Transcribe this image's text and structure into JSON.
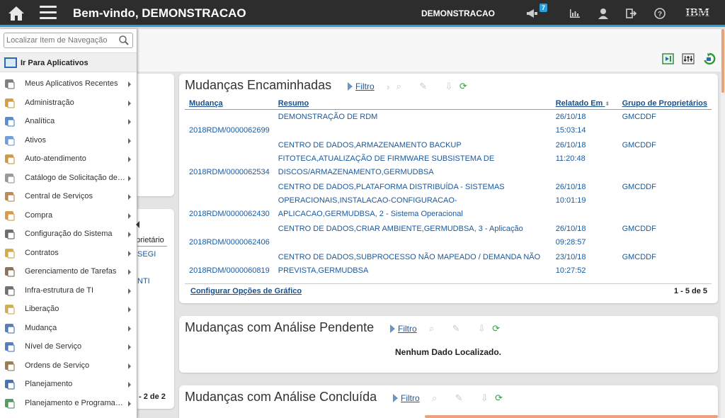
{
  "topbar": {
    "title": "Bem-vindo, DEMONSTRACAO",
    "user": "DEMONSTRACAO",
    "notification_count": "7",
    "brand": "IBM"
  },
  "nav": {
    "search_placeholder": "Localizar Item de Navegação",
    "goto_label": "Ir Para Aplicativos",
    "items": [
      {
        "label": "Meus Aplicativos Recentes",
        "icon": "clock-icon"
      },
      {
        "label": "Administração",
        "icon": "admin-icon"
      },
      {
        "label": "Analítica",
        "icon": "analytics-icon"
      },
      {
        "label": "Ativos",
        "icon": "assets-icon"
      },
      {
        "label": "Auto-atendimento",
        "icon": "cart-icon"
      },
      {
        "label": "Catálogo de Solicitação de Serviço",
        "icon": "catalog-icon"
      },
      {
        "label": "Central de Serviços",
        "icon": "service-desk-icon"
      },
      {
        "label": "Compra",
        "icon": "purchase-icon"
      },
      {
        "label": "Configuração do Sistema",
        "icon": "sliders-icon"
      },
      {
        "label": "Contratos",
        "icon": "contract-icon"
      },
      {
        "label": "Gerenciamento de Tarefas",
        "icon": "briefcase-icon"
      },
      {
        "label": "Infra-estrutura de TI",
        "icon": "computer-icon"
      },
      {
        "label": "Liberação",
        "icon": "release-icon"
      },
      {
        "label": "Mudança",
        "icon": "change-icon"
      },
      {
        "label": "Nível de Serviço",
        "icon": "service-level-icon"
      },
      {
        "label": "Ordens de Serviço",
        "icon": "work-order-icon"
      },
      {
        "label": "Planejamento",
        "icon": "planning-icon"
      },
      {
        "label": "Planejamento e Programação",
        "icon": "schedule-icon"
      }
    ]
  },
  "behind": {
    "col_fragment": "prietário",
    "cell1": "SEGI",
    "cell2": "NTI",
    "pager": "- 2 de 2"
  },
  "portlet1": {
    "title": "Mudanças Encaminhadas",
    "filter": "Filtro",
    "columns": [
      "Mudança",
      "Resumo",
      "Relatado Em",
      "Grupo de Proprietários"
    ],
    "rows": [
      {
        "id": "2018RDM/0000062699",
        "summary": [
          "DEMONSTRAÇÃO DE RDM"
        ],
        "date": "26/10/18",
        "time": "15:03:14",
        "group": "GMCDDF"
      },
      {
        "id": "2018RDM/0000062534",
        "summary": [
          "CENTRO DE DADOS,ARMAZENAMENTO BACKUP",
          "FITOTECA,ATUALIZAÇÃO DE FIRMWARE SUBSISTEMA DE",
          "DISCOS/ARMAZENAMENTO,GERMUDBSA"
        ],
        "date": "26/10/18",
        "time": "11:20:48",
        "group": "GMCDDF"
      },
      {
        "id": "2018RDM/0000062430",
        "summary": [
          "CENTRO DE DADOS,PLATAFORMA DISTRIBUÍDA - SISTEMAS",
          "OPERACIONAIS,INSTALACAO-CONFIGURACAO-",
          "APLICACAO,GERMUDBSA, 2 - Sistema Operacional"
        ],
        "date": "26/10/18",
        "time": "10:01:19",
        "group": "GMCDDF"
      },
      {
        "id": "2018RDM/0000062406",
        "summary": [
          "CENTRO DE DADOS,CRIAR AMBIENTE,GERMUDBSA, 3 - Aplicação"
        ],
        "date": "26/10/18",
        "time": "09:28:57",
        "group": "GMCDDF"
      },
      {
        "id": "2018RDM/0000060819",
        "summary": [
          "CENTRO DE DADOS,SUBPROCESSO NÃO MAPEADO / DEMANDA NÃO",
          "PREVISTA,GERMUDBSA"
        ],
        "date": "23/10/18",
        "time": "10:27:52",
        "group": "GMCDDF"
      }
    ],
    "config_link": "Configurar Opções de Gráfico",
    "pager": "1 - 5 de 5"
  },
  "portlet2": {
    "title": "Mudanças com Análise Pendente",
    "filter": "Filtro",
    "empty": "Nenhum Dado Localizado."
  },
  "portlet3": {
    "title": "Mudanças com Análise Concluída",
    "filter": "Filtro"
  }
}
